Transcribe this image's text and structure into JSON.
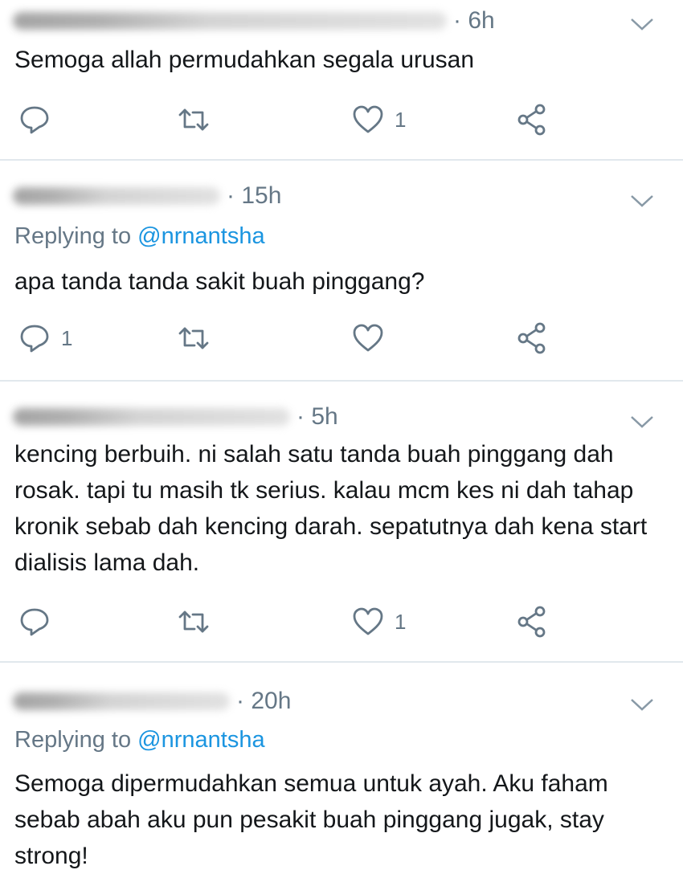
{
  "tweets": [
    {
      "time": "· 6h",
      "replying_prefix": "",
      "replying_handle": "",
      "text": "Semoga allah permudahkan segala urusan",
      "reply_count": "",
      "retweet_count": "",
      "like_count": "1"
    },
    {
      "time": "· 15h",
      "replying_prefix": "Replying to ",
      "replying_handle": "@nrnantsha",
      "text": "apa tanda tanda sakit buah pinggang?",
      "reply_count": "1",
      "retweet_count": "",
      "like_count": ""
    },
    {
      "time": "· 5h",
      "replying_prefix": "",
      "replying_handle": "",
      "text": "kencing berbuih. ni salah satu tanda buah pinggang dah rosak. tapi tu masih tk serius. kalau mcm kes ni dah tahap kronik sebab dah kencing darah. sepatutnya dah kena start dialisis lama dah.",
      "reply_count": "",
      "retweet_count": "",
      "like_count": "1"
    },
    {
      "time": "· 20h",
      "replying_prefix": "Replying to ",
      "replying_handle": "@nrnantsha",
      "text": "Semoga dipermudahkan semua untuk ayah. Aku faham sebab abah aku pun pesakit buah pinggang jugak, stay strong!",
      "reply_count": "",
      "retweet_count": "",
      "like_count": ""
    }
  ],
  "icons": {
    "reply": "reply-icon",
    "retweet": "retweet-icon",
    "like": "heart-icon",
    "share": "share-icon",
    "menu": "chevron-down-icon"
  },
  "colors": {
    "text": "#14171a",
    "muted": "#657786",
    "link": "#1b95e0",
    "divider": "#e1e8ed"
  }
}
